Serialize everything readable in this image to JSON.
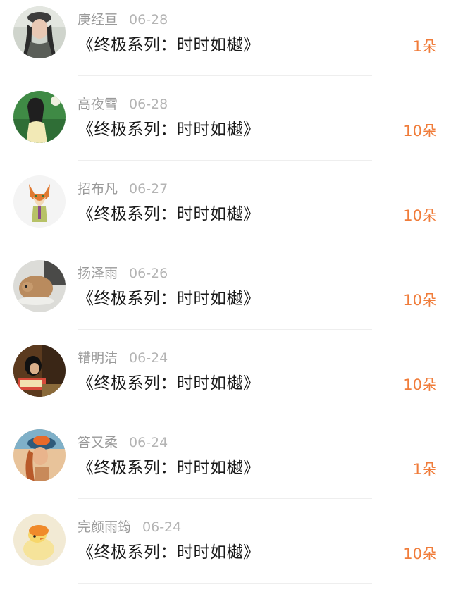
{
  "items": [
    {
      "name": "庚经亘",
      "date": "06-28",
      "title": "《终极系列：时时如樾》",
      "amount": "1朵"
    },
    {
      "name": "高夜雪",
      "date": "06-28",
      "title": "《终极系列：时时如樾》",
      "amount": "10朵"
    },
    {
      "name": "招布凡",
      "date": "06-27",
      "title": "《终极系列：时时如樾》",
      "amount": "10朵"
    },
    {
      "name": "扬泽雨",
      "date": "06-26",
      "title": "《终极系列：时时如樾》",
      "amount": "10朵"
    },
    {
      "name": "错明洁",
      "date": "06-24",
      "title": "《终极系列：时时如樾》",
      "amount": "10朵"
    },
    {
      "name": "答又柔",
      "date": "06-24",
      "title": "《终极系列：时时如樾》",
      "amount": "1朵"
    },
    {
      "name": "完颜雨筠",
      "date": "06-24",
      "title": "《终极系列：时时如樾》",
      "amount": "10朵"
    }
  ],
  "colors": {
    "accent": "#f07c3a",
    "meta": "#9a9a9a",
    "title": "#1a1a1a",
    "divider": "#eeeeee"
  },
  "avatars": [
    "woman-cap-photo",
    "woman-green-bg-photo",
    "fox-cartoon",
    "hamster-photo",
    "woman-reading-photo",
    "woman-hat-photo",
    "duckling-photo"
  ]
}
